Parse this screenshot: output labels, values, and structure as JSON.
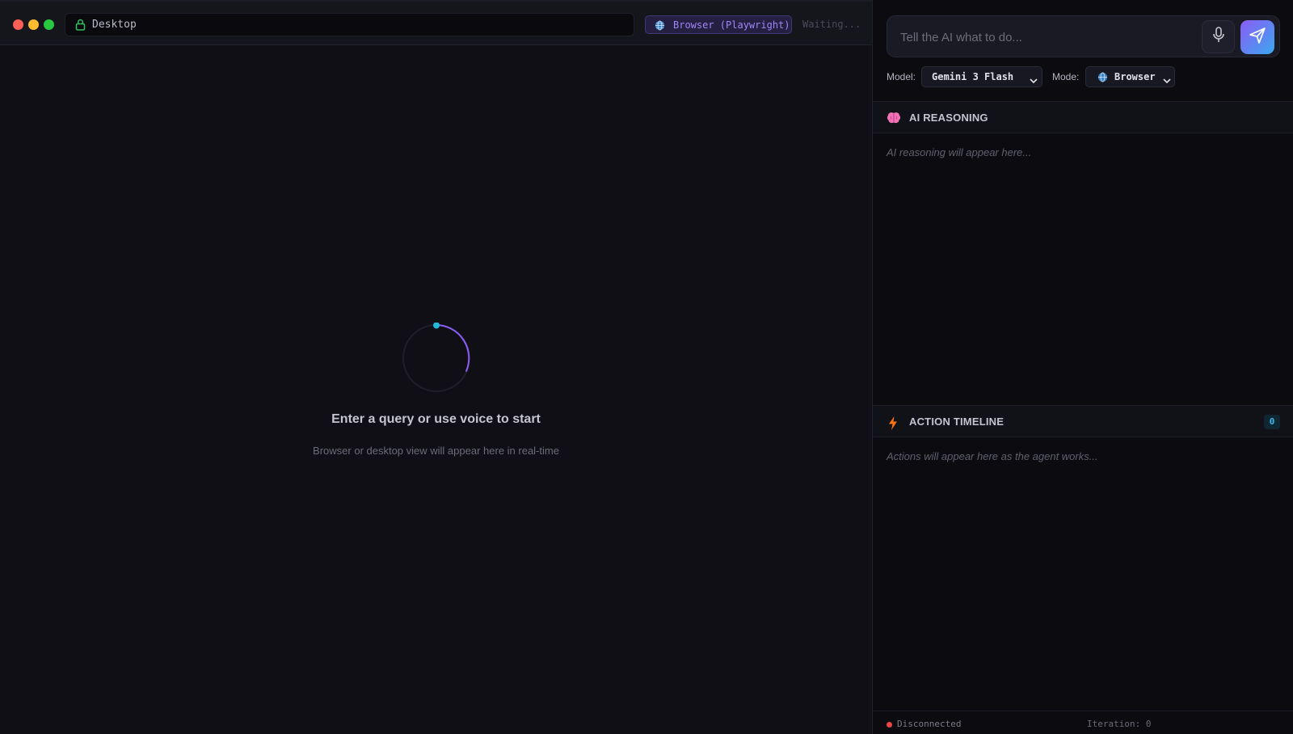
{
  "viewer": {
    "url": "Desktop",
    "mode_badge": "Browser (Playwright)",
    "status": "Waiting...",
    "empty_title": "Enter a query or use voice to start",
    "empty_subtitle": "Browser or desktop view will appear here in real-time"
  },
  "query": {
    "placeholder": "Tell the AI what to do...",
    "value": ""
  },
  "controls": {
    "model_label": "Model:",
    "model_value": "Gemini 3 Flash",
    "mode_label": "Mode:",
    "mode_value": "Browser"
  },
  "reasoning": {
    "title": "AI REASONING",
    "placeholder": "AI reasoning will appear here..."
  },
  "timeline": {
    "title": "ACTION TIMELINE",
    "count": "0",
    "placeholder": "Actions will appear here as the agent works..."
  },
  "footer": {
    "connection": "Disconnected",
    "iteration": "Iteration: 0"
  },
  "icons": {
    "lock": "lock-icon",
    "globe": "globe-icon",
    "mic": "microphone-icon",
    "send": "send-icon",
    "chevron": "chevron-down-icon",
    "brain": "brain-icon",
    "bolt": "lightning-icon"
  },
  "colors": {
    "accent_purple": "#8b5cf6",
    "accent_cyan": "#22b8d8",
    "close": "#ff5f57",
    "minimize": "#febc2e",
    "maximize": "#28c840",
    "disconnected": "#ef4444"
  }
}
